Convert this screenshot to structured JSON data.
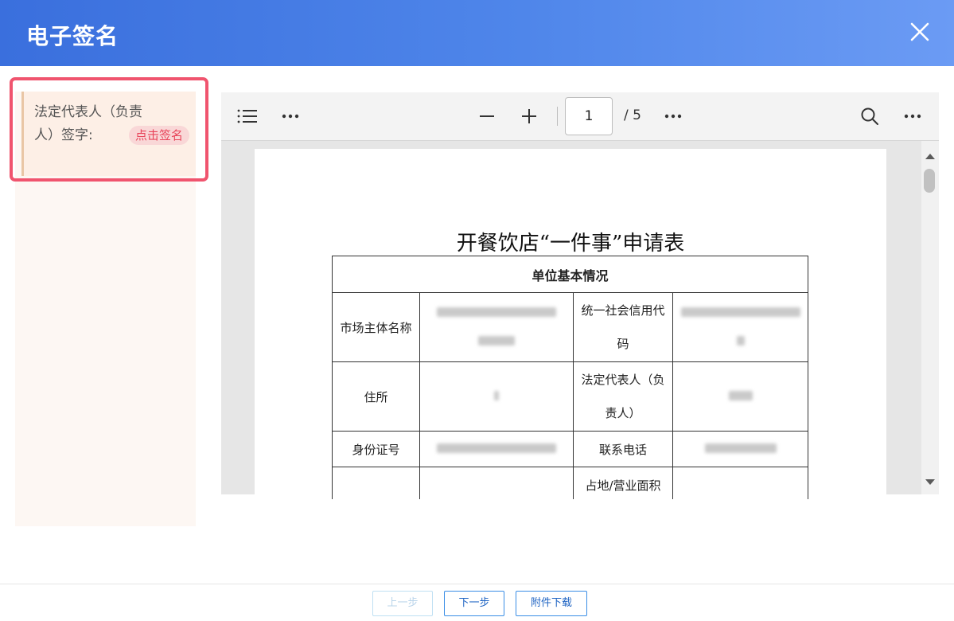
{
  "dialog": {
    "title": "电子签名"
  },
  "sidebar": {
    "sign_field": {
      "label": "法定代表人（负责人）签字:",
      "badge": "点击签名"
    }
  },
  "viewer": {
    "current_page": "1",
    "total_pages": "/ 5",
    "document": {
      "title": "开餐饮店“一件事”申请表",
      "section_header": "单位基本情况",
      "rows": [
        {
          "label1": "市场主体名称",
          "label2": "统一社会信用代码"
        },
        {
          "label1": "住所",
          "label2": "法定代表人（负责人）"
        },
        {
          "label1": "身份证号",
          "label2": "联系电话"
        },
        {
          "label1": "",
          "label2": "占地/营业面积"
        }
      ]
    }
  },
  "footer": {
    "prev_label": "上一步",
    "next_label": "下一步",
    "download_label": "附件下载"
  },
  "colors": {
    "header": "#3a6fdd",
    "accent": "#f0546e"
  }
}
